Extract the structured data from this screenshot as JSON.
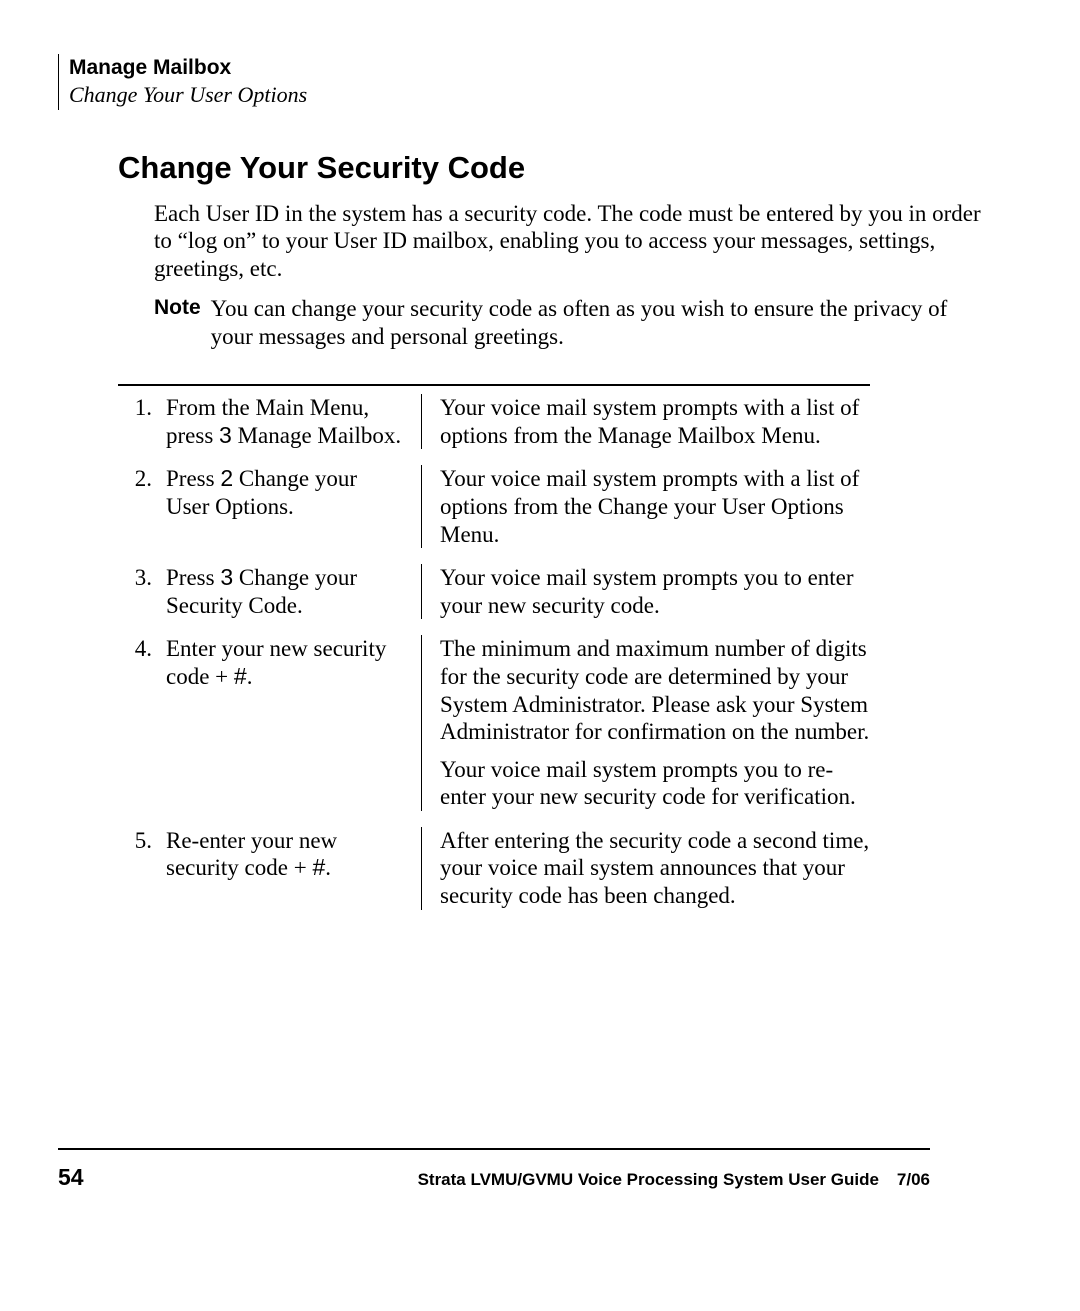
{
  "header": {
    "chapter": "Manage Mailbox",
    "section": "Change Your User Options"
  },
  "title": "Change Your Security Code",
  "intro": "Each User ID in the system has a security code. The code must be entered by you in order to “log on” to your User ID mailbox, enabling you to access your messages, settings, greetings, etc.",
  "note": {
    "label": "Note",
    "text": "You can change your security code as often as you wish to ensure the privacy of your messages and personal greetings."
  },
  "steps": [
    {
      "num": "1.",
      "action_pre": "From the Main Menu, press ",
      "action_key": "3",
      "action_post": " Manage Mailbox.",
      "description": [
        "Your voice mail system prompts with a list of options from the Manage Mailbox Menu."
      ]
    },
    {
      "num": "2.",
      "action_pre": "Press ",
      "action_key": "2",
      "action_post": " Change your User Options.",
      "description": [
        "Your voice mail system prompts with a list of options from the Change your User Options Menu."
      ]
    },
    {
      "num": "3.",
      "action_pre": "Press ",
      "action_key": "3",
      "action_post": " Change your Security Code.",
      "description": [
        "Your voice mail system prompts you to enter your new security code."
      ]
    },
    {
      "num": "4.",
      "action_pre": "Enter your new security code + ",
      "action_key": "#",
      "action_post": ".",
      "description": [
        "The minimum and maximum number of digits for the security code are determined by your System Administrator. Please ask your System Administrator for confirmation on the number.",
        "Your voice mail system prompts you to re-enter your new security code for verification."
      ]
    },
    {
      "num": "5.",
      "action_pre": "Re-enter your new security code + ",
      "action_key": "#",
      "action_post": ".",
      "description": [
        "After entering the security code a second time, your voice mail system announces that your security code has been changed."
      ]
    }
  ],
  "footer": {
    "page": "54",
    "guide": "Strata LVMU/GVMU Voice Processing System User Guide",
    "date": "7/06"
  }
}
